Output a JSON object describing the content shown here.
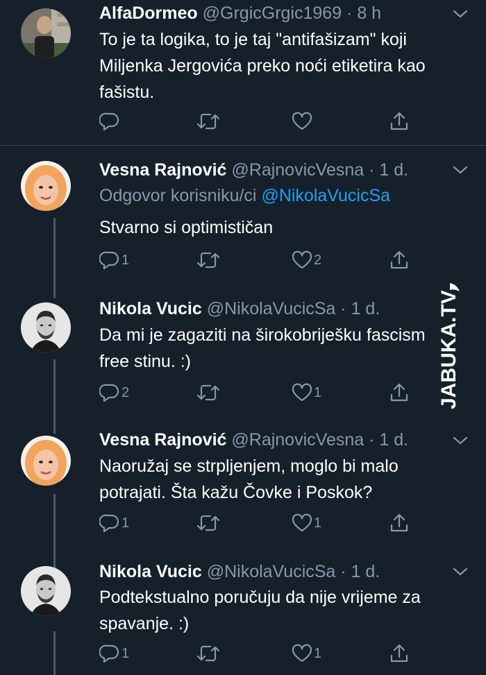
{
  "tweets": [
    {
      "name": "AlfaDormeo",
      "handle": "@GrgicGrgic1969",
      "separator": "·",
      "time": "8 h",
      "reply_prefix": "",
      "reply_mention": "",
      "text": "To je ta logika, to je taj \"antifašizam\" koji Miljenka Jergovića preko noći etiketira kao fašistu.",
      "reply_count": "",
      "like_count": ""
    },
    {
      "name": "Vesna Rajnović",
      "handle": "@RajnovicVesna",
      "separator": "·",
      "time": "1 d.",
      "reply_prefix": "Odgovor korisniku/ci ",
      "reply_mention": "@NikolaVucicSa",
      "text": "Stvarno si optimističan",
      "reply_count": "1",
      "like_count": "2"
    },
    {
      "name": "Nikola Vucic",
      "handle": "@NikolaVucicSa",
      "separator": "·",
      "time": "1 d.",
      "reply_prefix": "",
      "reply_mention": "",
      "text": "Da mi je zagaziti na širokobriješku fascism free stinu. :)",
      "reply_count": "2",
      "like_count": "1"
    },
    {
      "name": "Vesna Rajnović",
      "handle": "@RajnovicVesna",
      "separator": "·",
      "time": "1 d.",
      "reply_prefix": "",
      "reply_mention": "",
      "text": "Naoružaj se strpljenjem, moglo bi malo potrajati. Šta kažu Čovke i Poskok?",
      "reply_count": "1",
      "like_count": "1"
    },
    {
      "name": "Nikola Vucic",
      "handle": "@NikolaVucicSa",
      "separator": "·",
      "time": "1 d.",
      "reply_prefix": "",
      "reply_mention": "",
      "text": "Podtekstualno poručuju da nije vrijeme za spavanje. :)",
      "reply_count": "1",
      "like_count": "1"
    }
  ],
  "watermark": {
    "brand": "JABUKA.TV"
  },
  "icons": {
    "reply": "reply-icon",
    "retweet": "retweet-icon",
    "like": "heart-icon",
    "share": "share-icon",
    "more": "chevron-down-icon"
  },
  "colors": {
    "background": "#15202b",
    "divider": "#38444d",
    "secondary_text": "#8899a6",
    "link": "#1da1f2"
  }
}
